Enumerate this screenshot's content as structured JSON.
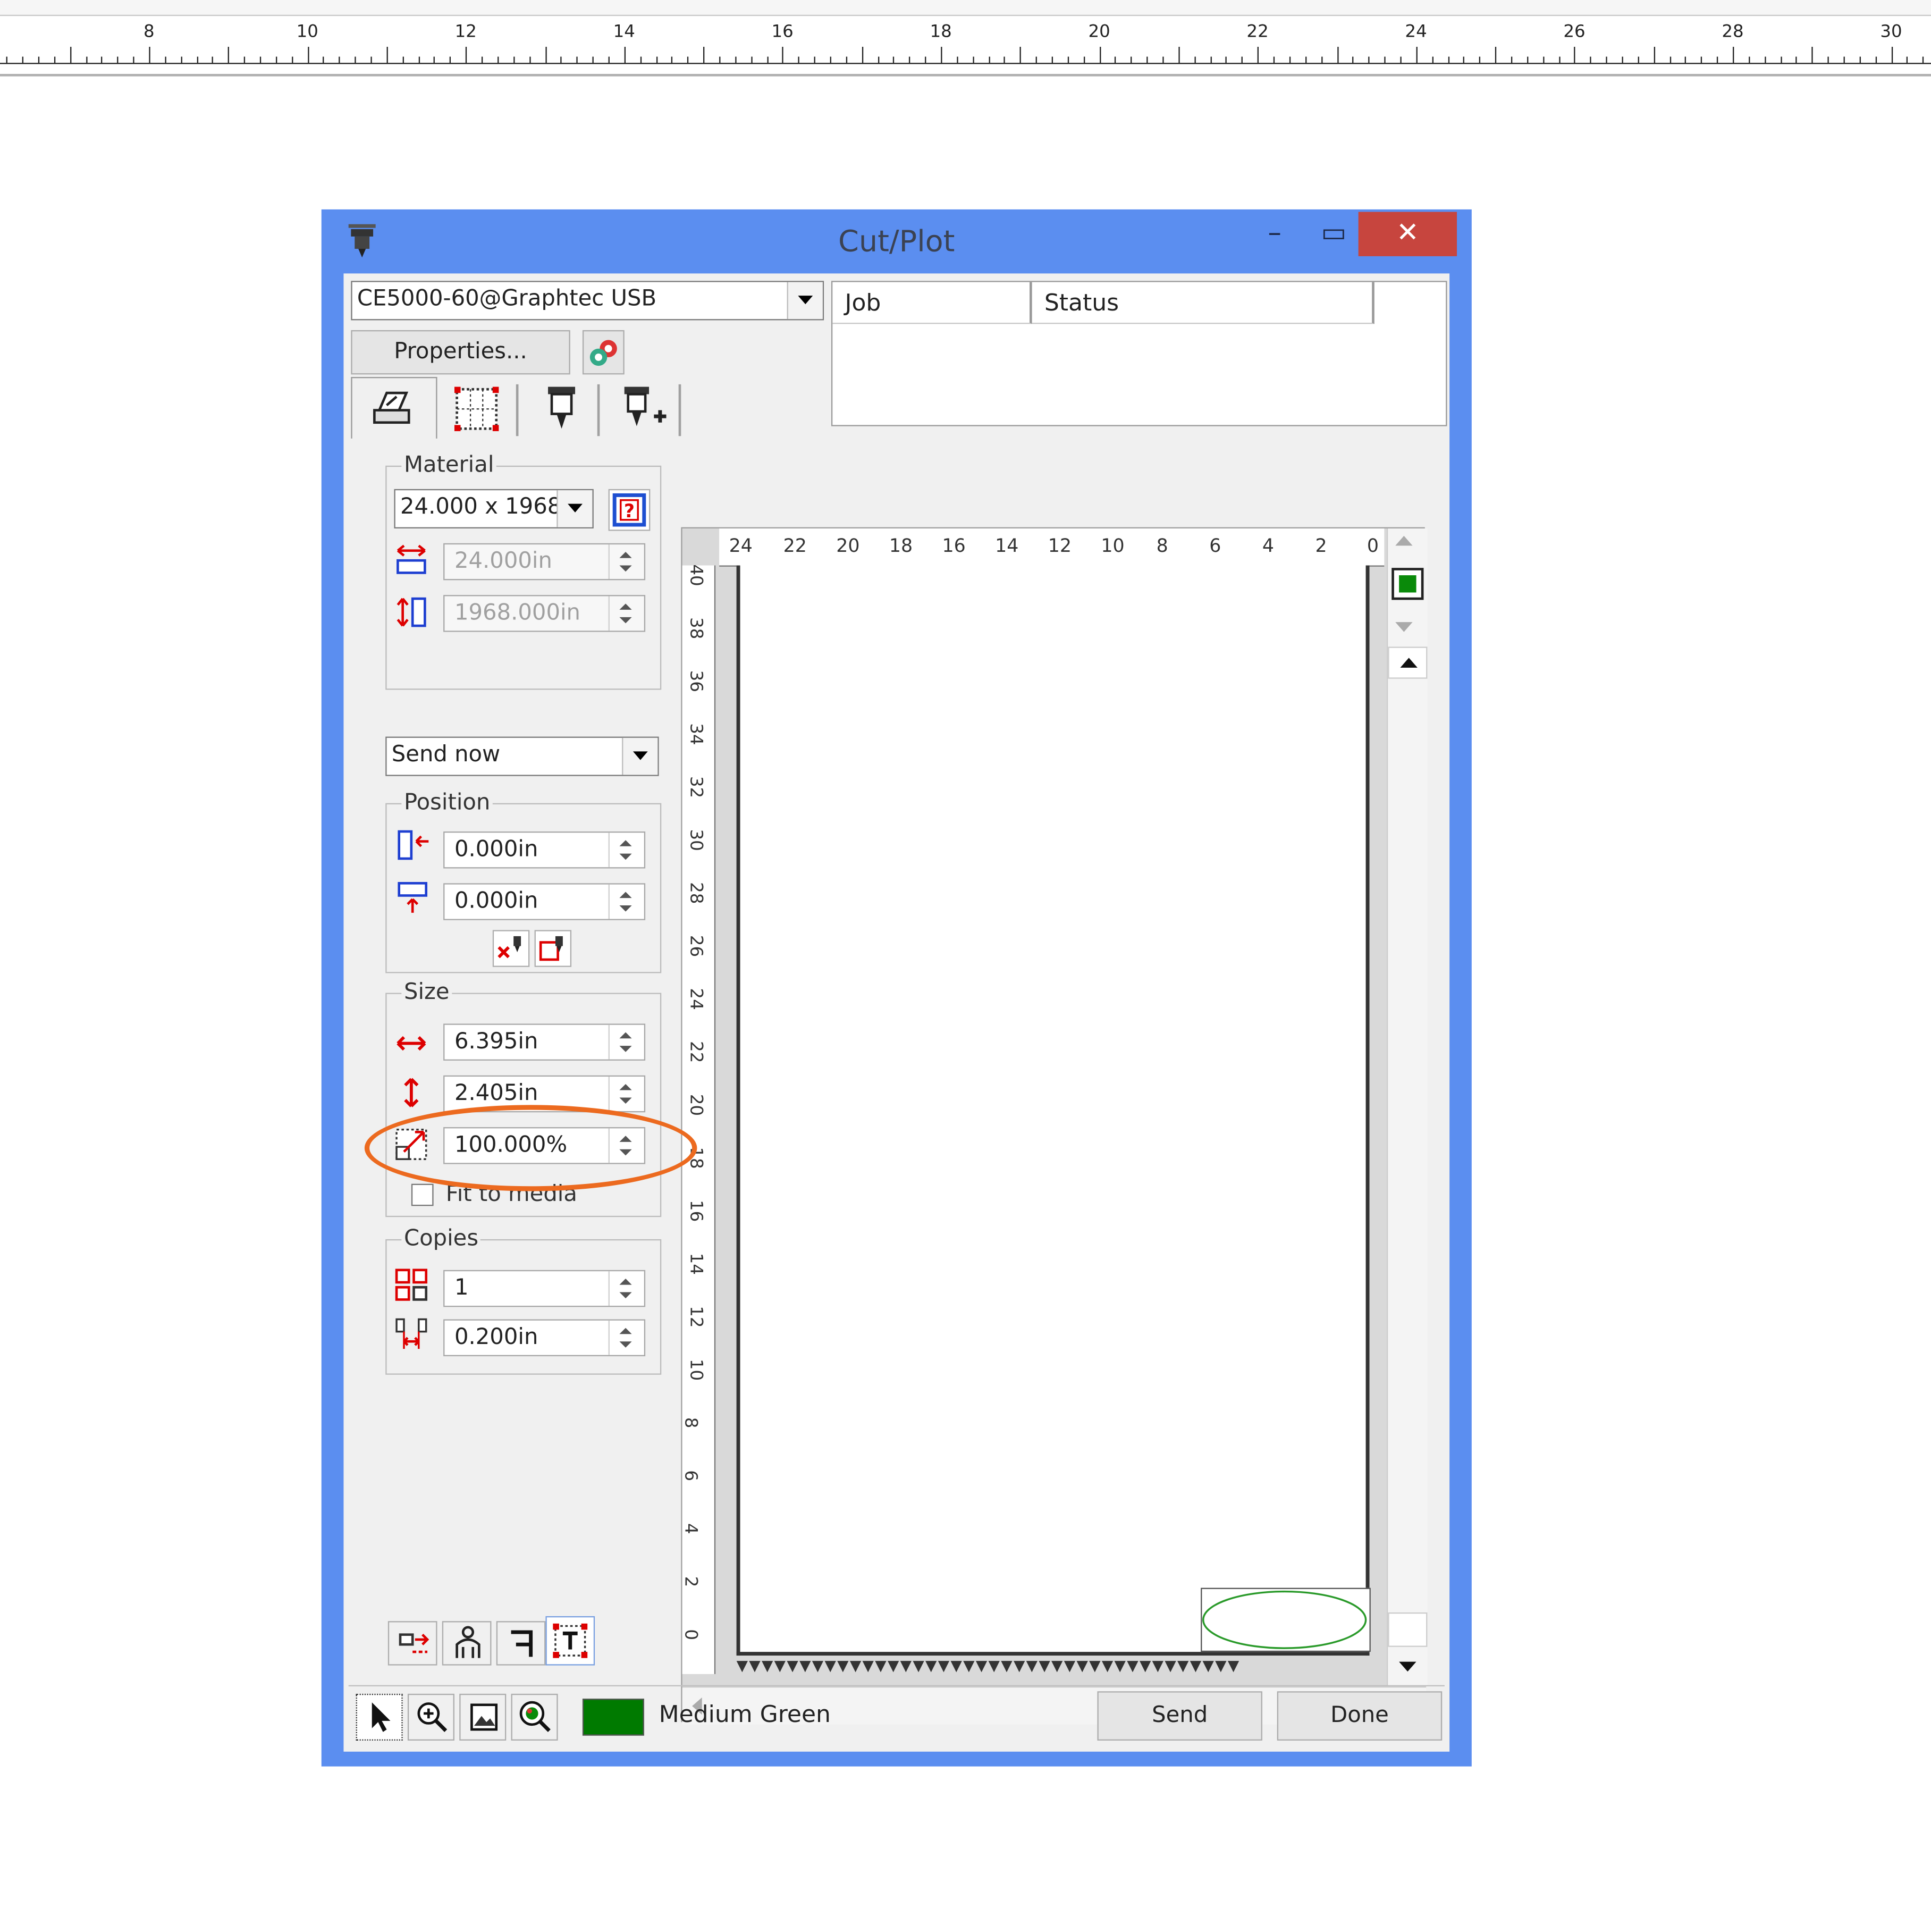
{
  "ruler": {
    "labels": [
      "8",
      "10",
      "12",
      "14",
      "16",
      "18",
      "20",
      "22",
      "24",
      "26",
      "28",
      "30"
    ]
  },
  "dialog": {
    "title": "Cut/Plot",
    "window_controls": {
      "minimize": "–",
      "maximize": "▭",
      "close": "✕"
    },
    "device": {
      "selected": "CE5000-60@Graphtec USB"
    },
    "properties_label": "Properties...",
    "job_list": {
      "columns": [
        "Job",
        "Status"
      ]
    },
    "material": {
      "label": "Material",
      "size_selected": "24.000 x 1968",
      "width": "24.000in",
      "length": "1968.000in"
    },
    "send_mode": {
      "selected": "Send now"
    },
    "position": {
      "label": "Position",
      "x": "0.000in",
      "y": "0.000in"
    },
    "size": {
      "label": "Size",
      "width": "6.395in",
      "height": "2.405in",
      "scale": "100.000%",
      "fit_to_media": "Fit to media",
      "fit_to_media_checked": false
    },
    "copies": {
      "label": "Copies",
      "count": "1",
      "spacing": "0.200in"
    },
    "preview": {
      "top_ruler": [
        "24",
        "22",
        "20",
        "18",
        "16",
        "14",
        "12",
        "10",
        "8",
        "6",
        "4",
        "2",
        "0"
      ],
      "left_ruler": [
        "40",
        "38",
        "36",
        "34",
        "32",
        "30",
        "28",
        "26",
        "24",
        "22",
        "20",
        "18",
        "16",
        "14",
        "12",
        "10",
        "8",
        "6",
        "4",
        "2",
        "0"
      ],
      "shape": "ellipse",
      "shape_color": "#2a9a2a"
    },
    "status": {
      "color_name": "Medium Green",
      "color_hex": "#007a00",
      "send_label": "Send",
      "done_label": "Done"
    },
    "highlight_color": "#ec6a1f"
  }
}
